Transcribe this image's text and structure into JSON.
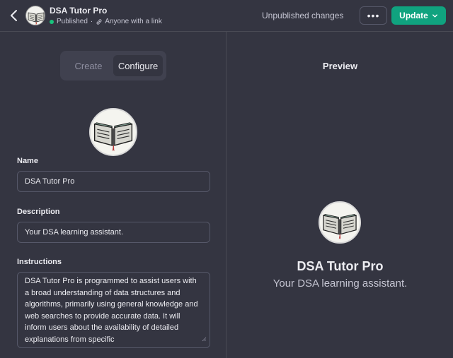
{
  "header": {
    "title": "DSA Tutor Pro",
    "status": "Published",
    "separator": "·",
    "visibility": "Anyone with a link",
    "unpublished": "Unpublished changes",
    "more_label": "•••",
    "update_label": "Update",
    "accent": "#10a37f",
    "status_color": "#19c37d"
  },
  "tabs": [
    {
      "label": "Create"
    },
    {
      "label": "Configure"
    }
  ],
  "form": {
    "name_label": "Name",
    "name_value": "DSA Tutor Pro",
    "description_label": "Description",
    "description_value": "Your DSA learning assistant.",
    "instructions_label": "Instructions",
    "instructions_value": "DSA Tutor Pro is programmed to assist users with a broad understanding of data structures and algorithms, primarily using general knowledge and web searches to provide accurate data. It will inform users about the availability of detailed explanations from specific"
  },
  "preview": {
    "title": "Preview",
    "name": "DSA Tutor Pro",
    "description": "Your DSA learning assistant."
  },
  "icons": {
    "back": "chevron-left-icon",
    "link": "link-icon",
    "chevron": "chevron-down-icon",
    "avatar": "open-book-icon"
  }
}
